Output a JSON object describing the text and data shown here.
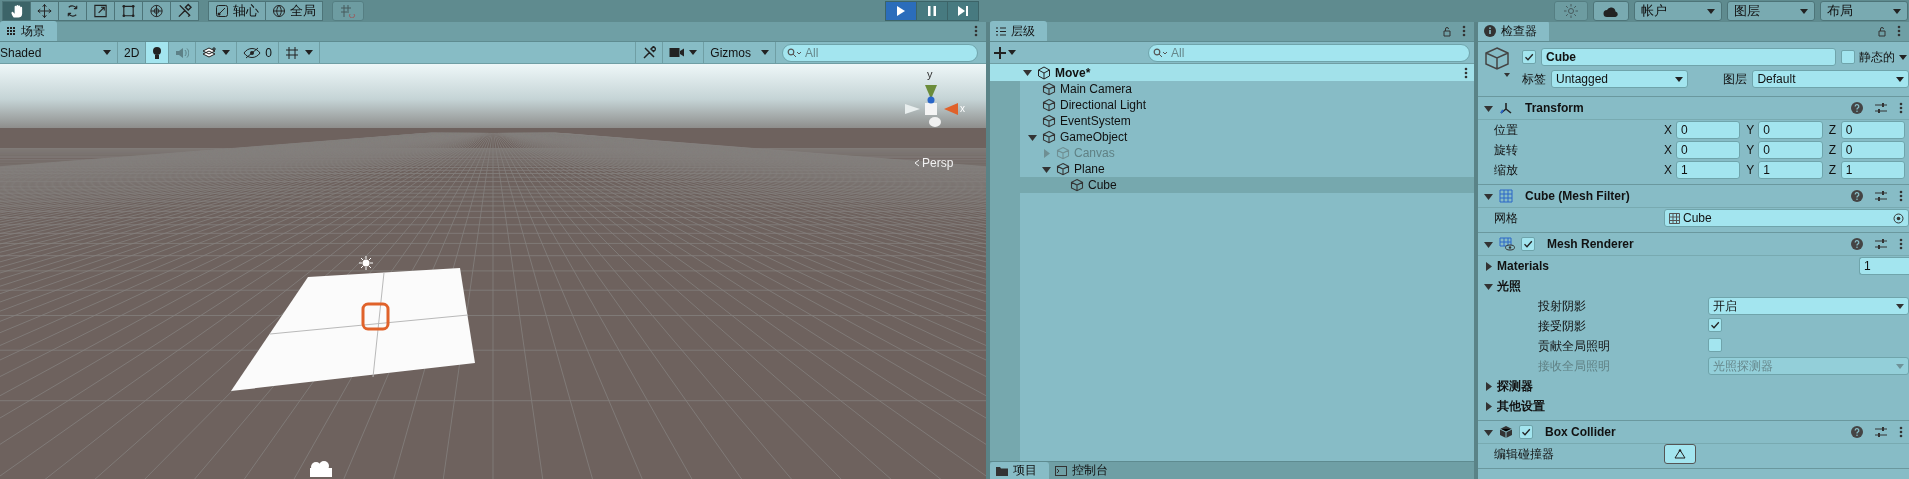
{
  "toolbar": {
    "tools": [
      {
        "selected": true
      },
      {
        "selected": false
      },
      {
        "selected": false
      },
      {
        "selected": false
      },
      {
        "selected": false
      },
      {
        "selected": false
      },
      {
        "selected": false
      }
    ],
    "pivot": "轴心",
    "space": "全局",
    "snap": {
      "disabled": true
    },
    "play": [
      {
        "selected": true
      },
      {
        "selected": false
      },
      {
        "selected": false
      }
    ],
    "effects": {
      "disabled": true
    },
    "menus": [
      "帐户",
      "图层",
      "布局"
    ]
  },
  "scene": {
    "tab": "场景",
    "shading": "Shaded",
    "toggles": [
      {
        "kind": "twod",
        "label": "2D",
        "on": false
      },
      {
        "kind": "lighting",
        "on": true
      },
      {
        "kind": "audio",
        "on": false
      },
      {
        "kind": "effects",
        "on": false
      },
      {
        "kind": "hidden",
        "label": "0",
        "on": false
      },
      {
        "kind": "grid",
        "on": false
      }
    ],
    "gizmos": "Gizmos",
    "search_placeholder": "All",
    "gizmo_axes": [
      "y",
      "x"
    ],
    "projection": "Persp"
  },
  "hierarchy": {
    "tab": "层级",
    "search_placeholder": "All",
    "scene": {
      "name": "Move*",
      "expanded": true,
      "children": [
        {
          "name": "Main Camera",
          "active": true,
          "selected": false
        },
        {
          "name": "Directional Light",
          "active": true,
          "selected": false
        },
        {
          "name": "EventSystem",
          "active": true,
          "selected": false
        },
        {
          "name": "GameObject",
          "active": true,
          "selected": false,
          "expanded": true,
          "children": [
            {
              "name": "Canvas",
              "active": false,
              "selected": false,
              "expanded": false
            },
            {
              "name": "Plane",
              "active": true,
              "selected": false,
              "expanded": true,
              "children": [
                {
                  "name": "Cube",
                  "active": true,
                  "selected": true
                }
              ]
            }
          ]
        }
      ]
    },
    "bottom_tabs": [
      {
        "label": "项目",
        "selected": true
      },
      {
        "label": "控制台",
        "selected": false
      }
    ]
  },
  "inspector": {
    "tab": "检查器",
    "object": {
      "active": true,
      "name": "Cube",
      "static": false,
      "static_label": "静态的",
      "tag_label": "标签",
      "tag": "Untagged",
      "layer_label": "图层",
      "layer": "Default"
    },
    "components": [
      {
        "kind": "transform",
        "title": "Transform",
        "expanded": true,
        "rows": [
          {
            "kind": "vector",
            "label": "位置",
            "values": [
              {
                "axis": "X",
                "value": "0"
              },
              {
                "axis": "Y",
                "value": "0"
              },
              {
                "axis": "Z",
                "value": "0"
              }
            ]
          },
          {
            "kind": "vector",
            "label": "旋转",
            "values": [
              {
                "axis": "X",
                "value": "0"
              },
              {
                "axis": "Y",
                "value": "0"
              },
              {
                "axis": "Z",
                "value": "0"
              }
            ]
          },
          {
            "kind": "vector",
            "label": "缩放",
            "values": [
              {
                "axis": "X",
                "value": "1"
              },
              {
                "axis": "Y",
                "value": "1"
              },
              {
                "axis": "Z",
                "value": "1"
              }
            ]
          }
        ]
      },
      {
        "kind": "meshfilter",
        "title": "Cube (Mesh Filter)",
        "expanded": true,
        "rows": [
          {
            "kind": "object",
            "label": "网格",
            "value": "Cube"
          }
        ]
      },
      {
        "kind": "meshrenderer",
        "title": "Mesh Renderer",
        "expanded": true,
        "enabled": true,
        "rows": [
          {
            "kind": "foldout",
            "label": "Materials",
            "expanded": false,
            "value": "1"
          },
          {
            "kind": "foldout",
            "label": "光照",
            "expanded": true,
            "children": [
              {
                "kind": "dropdown",
                "label": "投射阴影",
                "value": "开启",
                "disabled": false
              },
              {
                "kind": "checkbox",
                "label": "接受阴影",
                "checked": true
              },
              {
                "kind": "checkbox",
                "label": "贡献全局照明",
                "checked": false
              },
              {
                "kind": "dropdown",
                "label": "接收全局照明",
                "value": "光照探测器",
                "disabled": true
              }
            ]
          },
          {
            "kind": "foldout",
            "label": "探测器",
            "expanded": false
          },
          {
            "kind": "foldout",
            "label": "其他设置",
            "expanded": false
          }
        ]
      },
      {
        "kind": "boxcollider",
        "title": "Box Collider",
        "expanded": true,
        "enabled": true,
        "rows": [
          {
            "kind": "editbutton",
            "label": "编辑碰撞器"
          }
        ]
      }
    ]
  }
}
